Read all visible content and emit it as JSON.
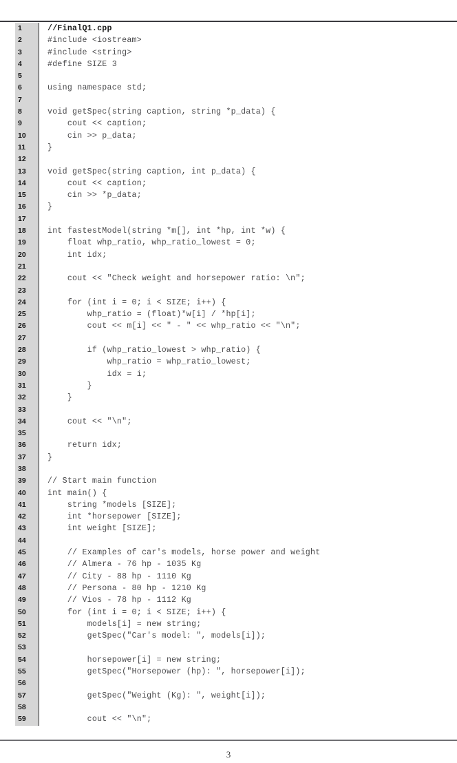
{
  "document": {
    "page_number": "3",
    "listing": {
      "language": "cpp",
      "lines": [
        {
          "n": "1",
          "text": "//FinalQ1.cpp",
          "bold": true
        },
        {
          "n": "2",
          "text": "#include <iostream>"
        },
        {
          "n": "3",
          "text": "#include <string>"
        },
        {
          "n": "4",
          "text": "#define SIZE 3"
        },
        {
          "n": "5",
          "text": ""
        },
        {
          "n": "6",
          "text": "using namespace std;"
        },
        {
          "n": "7",
          "text": ""
        },
        {
          "n": "8",
          "text": "void getSpec(string caption, string *p_data) {"
        },
        {
          "n": "9",
          "text": "    cout << caption;"
        },
        {
          "n": "10",
          "text": "    cin >> p_data;"
        },
        {
          "n": "11",
          "text": "}"
        },
        {
          "n": "12",
          "text": ""
        },
        {
          "n": "13",
          "text": "void getSpec(string caption, int p_data) {"
        },
        {
          "n": "14",
          "text": "    cout << caption;"
        },
        {
          "n": "15",
          "text": "    cin >> *p_data;"
        },
        {
          "n": "16",
          "text": "}"
        },
        {
          "n": "17",
          "text": ""
        },
        {
          "n": "18",
          "text": "int fastestModel(string *m[], int *hp, int *w) {"
        },
        {
          "n": "19",
          "text": "    float whp_ratio, whp_ratio_lowest = 0;"
        },
        {
          "n": "20",
          "text": "    int idx;"
        },
        {
          "n": "21",
          "text": ""
        },
        {
          "n": "22",
          "text": "    cout << \"Check weight and horsepower ratio: \\n\";"
        },
        {
          "n": "23",
          "text": ""
        },
        {
          "n": "24",
          "text": "    for (int i = 0; i < SIZE; i++) {"
        },
        {
          "n": "25",
          "text": "        whp_ratio = (float)*w[i] / *hp[i];"
        },
        {
          "n": "26",
          "text": "        cout << m[i] << \" - \" << whp_ratio << \"\\n\";"
        },
        {
          "n": "27",
          "text": ""
        },
        {
          "n": "28",
          "text": "        if (whp_ratio_lowest > whp_ratio) {"
        },
        {
          "n": "29",
          "text": "            whp_ratio = whp_ratio_lowest;"
        },
        {
          "n": "30",
          "text": "            idx = i;"
        },
        {
          "n": "31",
          "text": "        }"
        },
        {
          "n": "32",
          "text": "    }"
        },
        {
          "n": "33",
          "text": ""
        },
        {
          "n": "34",
          "text": "    cout << \"\\n\";"
        },
        {
          "n": "35",
          "text": ""
        },
        {
          "n": "36",
          "text": "    return idx;"
        },
        {
          "n": "37",
          "text": "}"
        },
        {
          "n": "38",
          "text": ""
        },
        {
          "n": "39",
          "text": "// Start main function"
        },
        {
          "n": "40",
          "text": "int main() {"
        },
        {
          "n": "41",
          "text": "    string *models [SIZE];"
        },
        {
          "n": "42",
          "text": "    int *horsepower [SIZE];"
        },
        {
          "n": "43",
          "text": "    int weight [SIZE];"
        },
        {
          "n": "44",
          "text": ""
        },
        {
          "n": "45",
          "text": "    // Examples of car's models, horse power and weight"
        },
        {
          "n": "46",
          "text": "    // Almera - 76 hp - 1035 Kg"
        },
        {
          "n": "47",
          "text": "    // City - 88 hp - 1110 Kg"
        },
        {
          "n": "48",
          "text": "    // Persona - 80 hp - 1210 Kg"
        },
        {
          "n": "49",
          "text": "    // Vios - 78 hp - 1112 Kg"
        },
        {
          "n": "50",
          "text": "    for (int i = 0; i < SIZE; i++) {"
        },
        {
          "n": "51",
          "text": "        models[i] = new string;"
        },
        {
          "n": "52",
          "text": "        getSpec(\"Car's model: \", models[i]);"
        },
        {
          "n": "53",
          "text": ""
        },
        {
          "n": "54",
          "text": "        horsepower[i] = new string;"
        },
        {
          "n": "55",
          "text": "        getSpec(\"Horsepower (hp): \", horsepower[i]);"
        },
        {
          "n": "56",
          "text": ""
        },
        {
          "n": "57",
          "text": "        getSpec(\"Weight (Kg): \", weight[i]);"
        },
        {
          "n": "58",
          "text": ""
        },
        {
          "n": "59",
          "text": "        cout << \"\\n\";"
        }
      ]
    }
  },
  "colors": {
    "gutter_background": "#d6d6d6",
    "gutter_text": "#161616",
    "code_text": "#4a4a4c",
    "rule": "#3b3b3f",
    "page_background": "#ffffff"
  }
}
